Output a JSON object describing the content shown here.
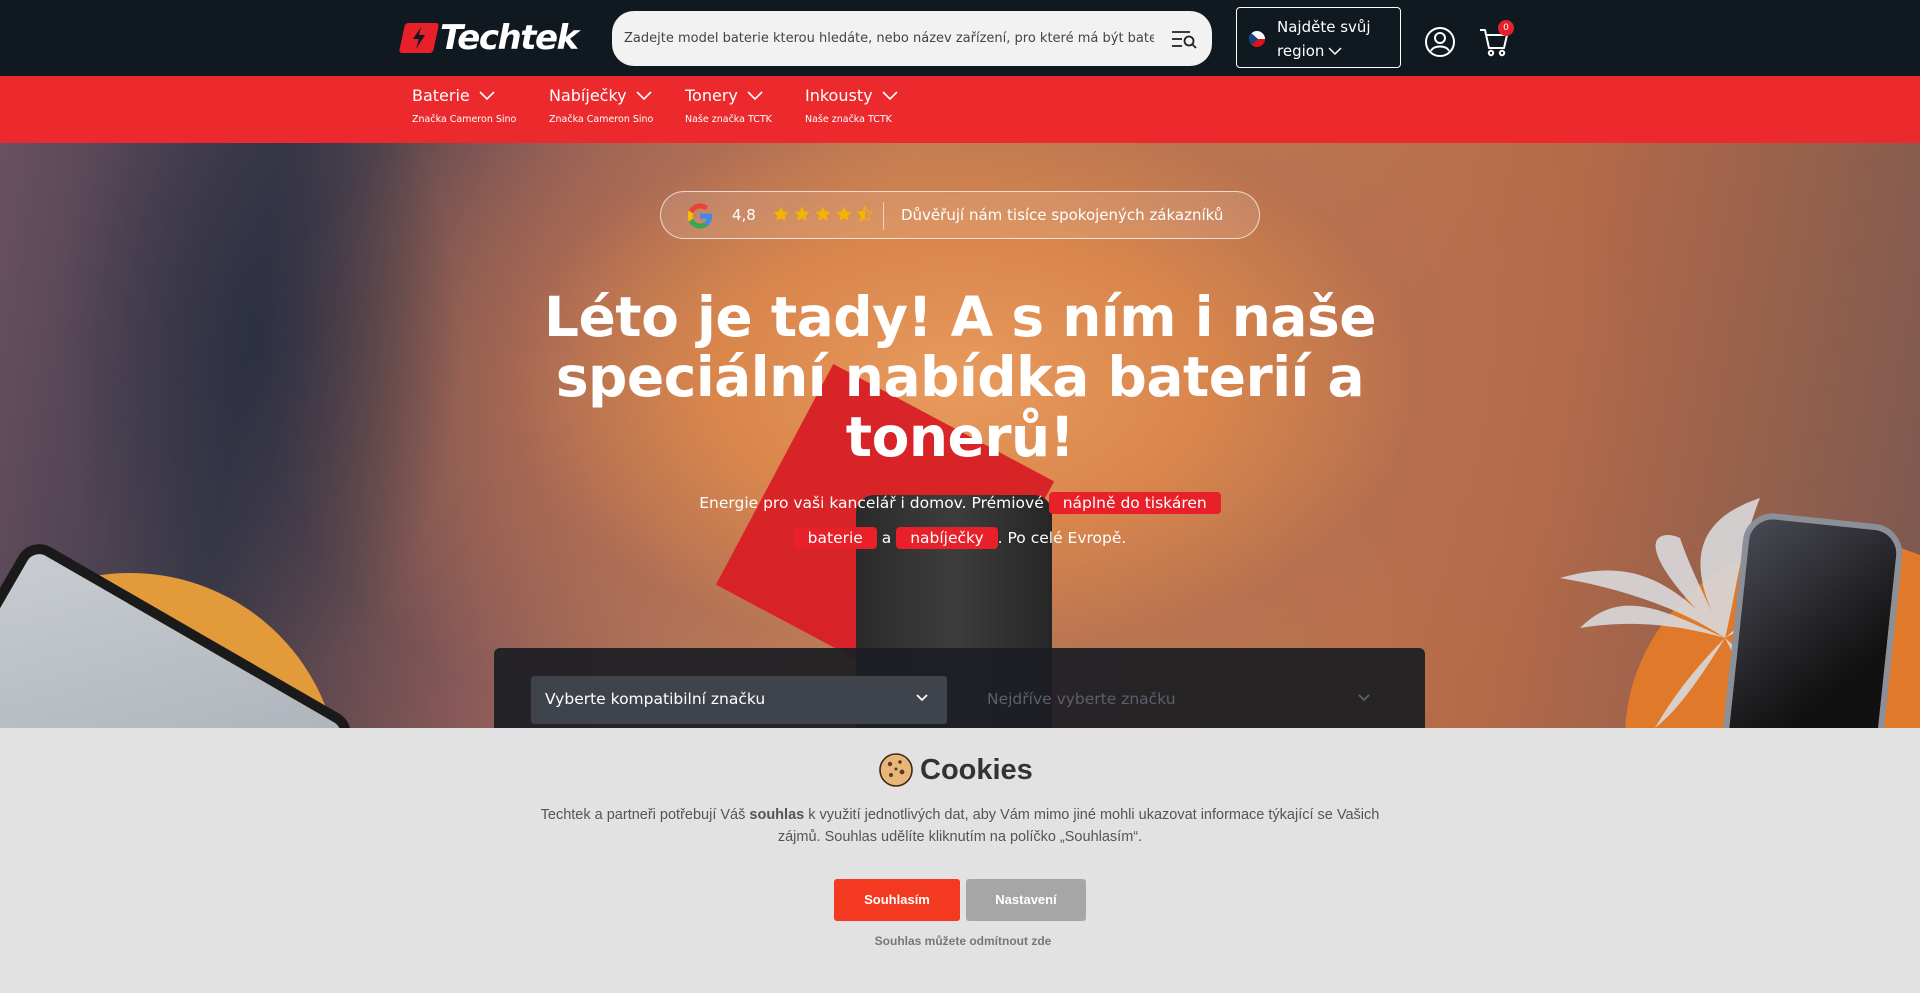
{
  "header": {
    "logo_text": "Techtek",
    "search_placeholder": "Zadejte model baterie kterou hledáte, nebo název zařízení, pro které má být bater",
    "region_line1": "Najděte svůj",
    "region_line2": "region",
    "cart_count": "0"
  },
  "nav": {
    "items": [
      {
        "label": "Baterie",
        "sub": "Značka Cameron Sino"
      },
      {
        "label": "Nabíječky",
        "sub": "Značka Cameron Sino"
      },
      {
        "label": "Tonery",
        "sub": "Naše značka TCTK"
      },
      {
        "label": "Inkousty",
        "sub": "Naše značka TCTK"
      }
    ]
  },
  "hero": {
    "rating_value": "4,8",
    "rating_stars": 4.5,
    "rating_text": "Důvěřují nám tisíce spokojených zákazníků",
    "title": "Léto je tady! A s ním i naše speciální nabídka baterií a tonerů!",
    "sub_part1": "Energie pro vaši kancelář i domov. Prémiové",
    "sub_pill1": "náplně do tiskáren",
    "sub_pill2": "baterie",
    "sub_and": "a",
    "sub_pill3": "nabíječky",
    "sub_part2": ". Po celé Evropě."
  },
  "finder": {
    "brand_select": "Vyberte kompatibilní značku",
    "model_select": "Nejdříve vyberte značku"
  },
  "cookies": {
    "title": "Cookies",
    "text_before": "Techtek a partneři potřebují Váš ",
    "text_bold": "souhlas",
    "text_after": " k využití jednotlivých dat, aby Vám mimo jiné mohli ukazovat informace týkající se Vašich zájmů. Souhlas udělíte kliknutím na políčko „Souhlasím“.",
    "accept_label": "Souhlasím",
    "settings_label": "Nastavení",
    "reject_label": "Souhlas můžete odmítnout zde"
  },
  "colors": {
    "header_bg": "#101820",
    "nav_bg": "#ec2a2d",
    "accent": "#e8202a",
    "accept_btn": "#f33a20",
    "settings_btn": "#a6a6a6"
  }
}
